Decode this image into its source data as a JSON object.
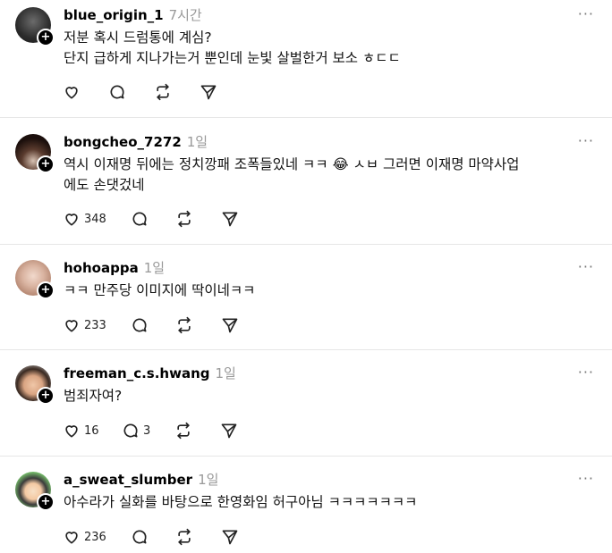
{
  "more_label": "···",
  "posts": [
    {
      "username": "blue_origin_1",
      "time": "7시간",
      "text": "저분 혹시 드럼통에 계심?\n단지 급하게 지나가는거 뿐인데 눈빛 살벌한거 보소 ㅎㄷㄷ",
      "likes": "",
      "replies": ""
    },
    {
      "username": "bongcheo_7272",
      "time": "1일",
      "text": "역시 이재명 뒤에는 정치깡패 조폭들있네 ㅋㅋ 😂 ㅅㅂ 그러면 이재명 마약사업\n에도 손댓겄네",
      "likes": "348",
      "replies": ""
    },
    {
      "username": "hohoappa",
      "time": "1일",
      "text": "ㅋㅋ 만주당 이미지에 딱이네ㅋㅋ",
      "likes": "233",
      "replies": ""
    },
    {
      "username": "freeman_c.s.hwang",
      "time": "1일",
      "text": "범죄자여?",
      "likes": "16",
      "replies": "3"
    },
    {
      "username": "a_sweat_slumber",
      "time": "1일",
      "text": "아수라가 실화를 바탕으로 한영화임 허구아님 ㅋㅋㅋㅋㅋㅋㅋ",
      "likes": "236",
      "replies": ""
    }
  ]
}
